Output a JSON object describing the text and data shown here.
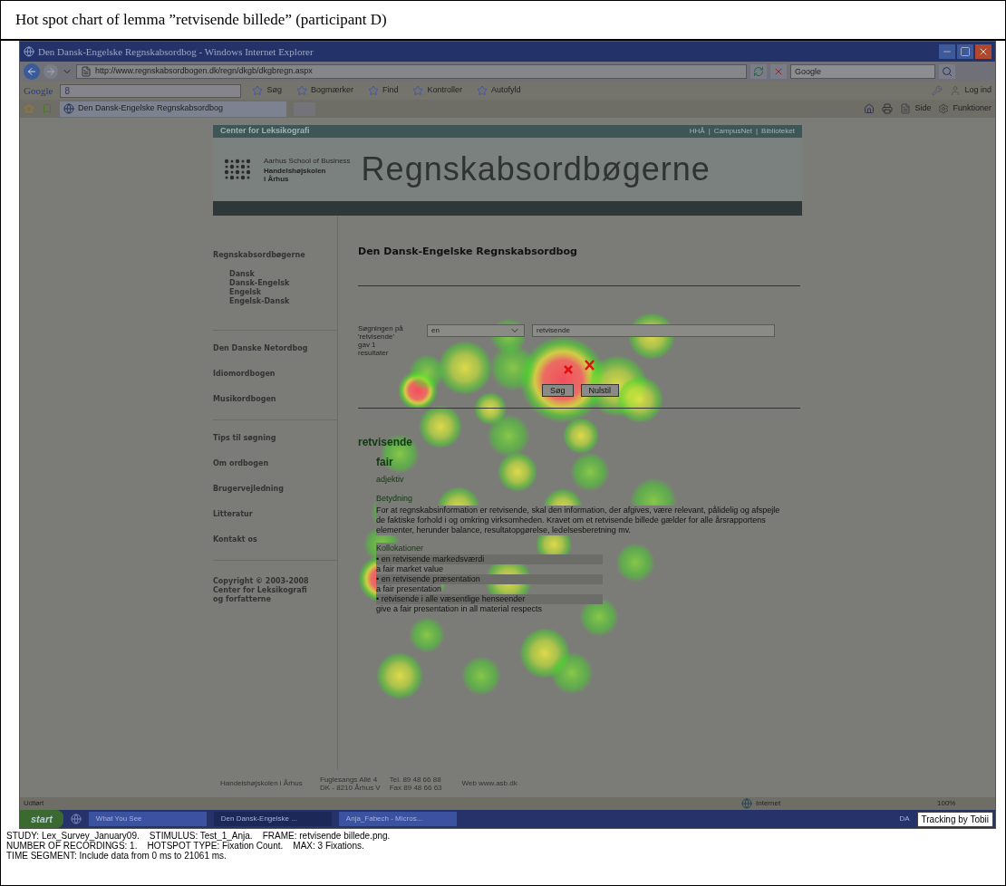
{
  "caption": "Hot spot chart of lemma ”retvisende billede” (participant D)",
  "window": {
    "title": "Den Dansk-Engelske Regnskabsordbog - Windows Internet Explorer"
  },
  "address_bar": {
    "value": "http://www.regnskabsordbogen.dk/regn/dkgb/dkgbregn.aspx",
    "search_placeholder": "Google"
  },
  "google_toolbar": {
    "logo": "Google",
    "field": "8",
    "items": [
      "Søg",
      "Bogmærker",
      "Find",
      "Kontroller",
      "Autofyld"
    ],
    "login": "Log ind"
  },
  "tab_bar": {
    "tab": "Den Dansk-Engelske Regnskabsordbog",
    "commands": [
      "Side",
      "Funktioner"
    ]
  },
  "site": {
    "top_left": "Center for Leksikografi",
    "top_links": [
      "HHÅ",
      "|",
      "CampusNet",
      "|",
      "Biblioteket"
    ],
    "school_small": "Aarhus School of Business",
    "school_name": [
      "Handelshøjskolen",
      "i Århus"
    ],
    "banner_title": "Regnskabsordbøgerne"
  },
  "sidebar": [
    {
      "label": "Regnskabsordbøgerne",
      "children": [
        {
          "label": "Dansk"
        },
        {
          "label": "Dansk-Engelsk"
        },
        {
          "label": "Engelsk"
        },
        {
          "label": "Engelsk-Dansk"
        }
      ]
    },
    {
      "label": "Den Danske Netordbog"
    },
    {
      "label": "Idiomordbogen"
    },
    {
      "label": "Musikordbogen"
    },
    {
      "label": "Tips til søgning"
    },
    {
      "label": "Om ordbogen"
    },
    {
      "label": "Brugervejledning"
    },
    {
      "label": "Litteratur"
    },
    {
      "label": "Kontakt os"
    }
  ],
  "copyright": [
    "Copyright © 2003-2008",
    "Center for Leksikografi",
    "og forfatterne"
  ],
  "main": {
    "title": "Den Dansk-Engelske Regnskabsordbog",
    "search_result": [
      "Søgningen på",
      "'retvisende'",
      "gav 1",
      "resultater"
    ],
    "select_value": "en",
    "query": "retvisende",
    "buttons": [
      "Søg",
      "Nulstil"
    ],
    "headword": "retvisende",
    "equivalent": "fair",
    "pos": "adjektiv",
    "meaning_label": "Betydning",
    "definition": "For at regnskabsinformation er retvisende, skal den information, der afgives, være relevant, pålidelig og afspejle de faktiske forhold i og omkring virksomheden. Kravet om et retvisende billede gælder for alle årsrapportens elementer, herunder balance, resultatopgørelse, ledelsesberetning mv.",
    "collocations_label": "Kollokationer",
    "collocations": [
      {
        "danish": "• en retvisende markedsværdi",
        "english": "a fair market value"
      },
      {
        "danish": "• en retvisende præsentation",
        "english": "a fair presentation"
      },
      {
        "danish": "• retvisende i alle væsentlige henseender",
        "english": "give a fair presentation in all material respects"
      }
    ]
  },
  "footer": {
    "school": "Handelshøjskolen i Århus",
    "address": [
      "Fuglesangs Allé 4",
      "DK - 8210 Århus V"
    ],
    "phone": [
      "Tel. 89 48 66 88",
      "Fax 89 48 66 63"
    ],
    "web": "Web www.asb.dk"
  },
  "status_bar": {
    "text": "Udført",
    "zone": "Internet",
    "zoom": "100%"
  },
  "taskbar": {
    "start": "start",
    "tasks": [
      {
        "label": "What You See",
        "selected": false
      },
      {
        "label": "Den Dansk-Engelske ...",
        "selected": true
      },
      {
        "label": "Anja_Fabech - Micros...",
        "selected": false
      }
    ],
    "tray": "DA",
    "overlay": "Tracking by Tobii"
  },
  "info": [
    "STUDY: Lex_Survey_January09.    STIMULUS: Test_1_Anja.    FRAME: retvisende billede.png.",
    "NUMBER OF RECORDINGS: 1.    HOTSPOT TYPE: Fixation Count.    MAX: 3 Fixations.",
    "TIME SEGMENT: Include data from 0 ms to 21061 ms."
  ]
}
